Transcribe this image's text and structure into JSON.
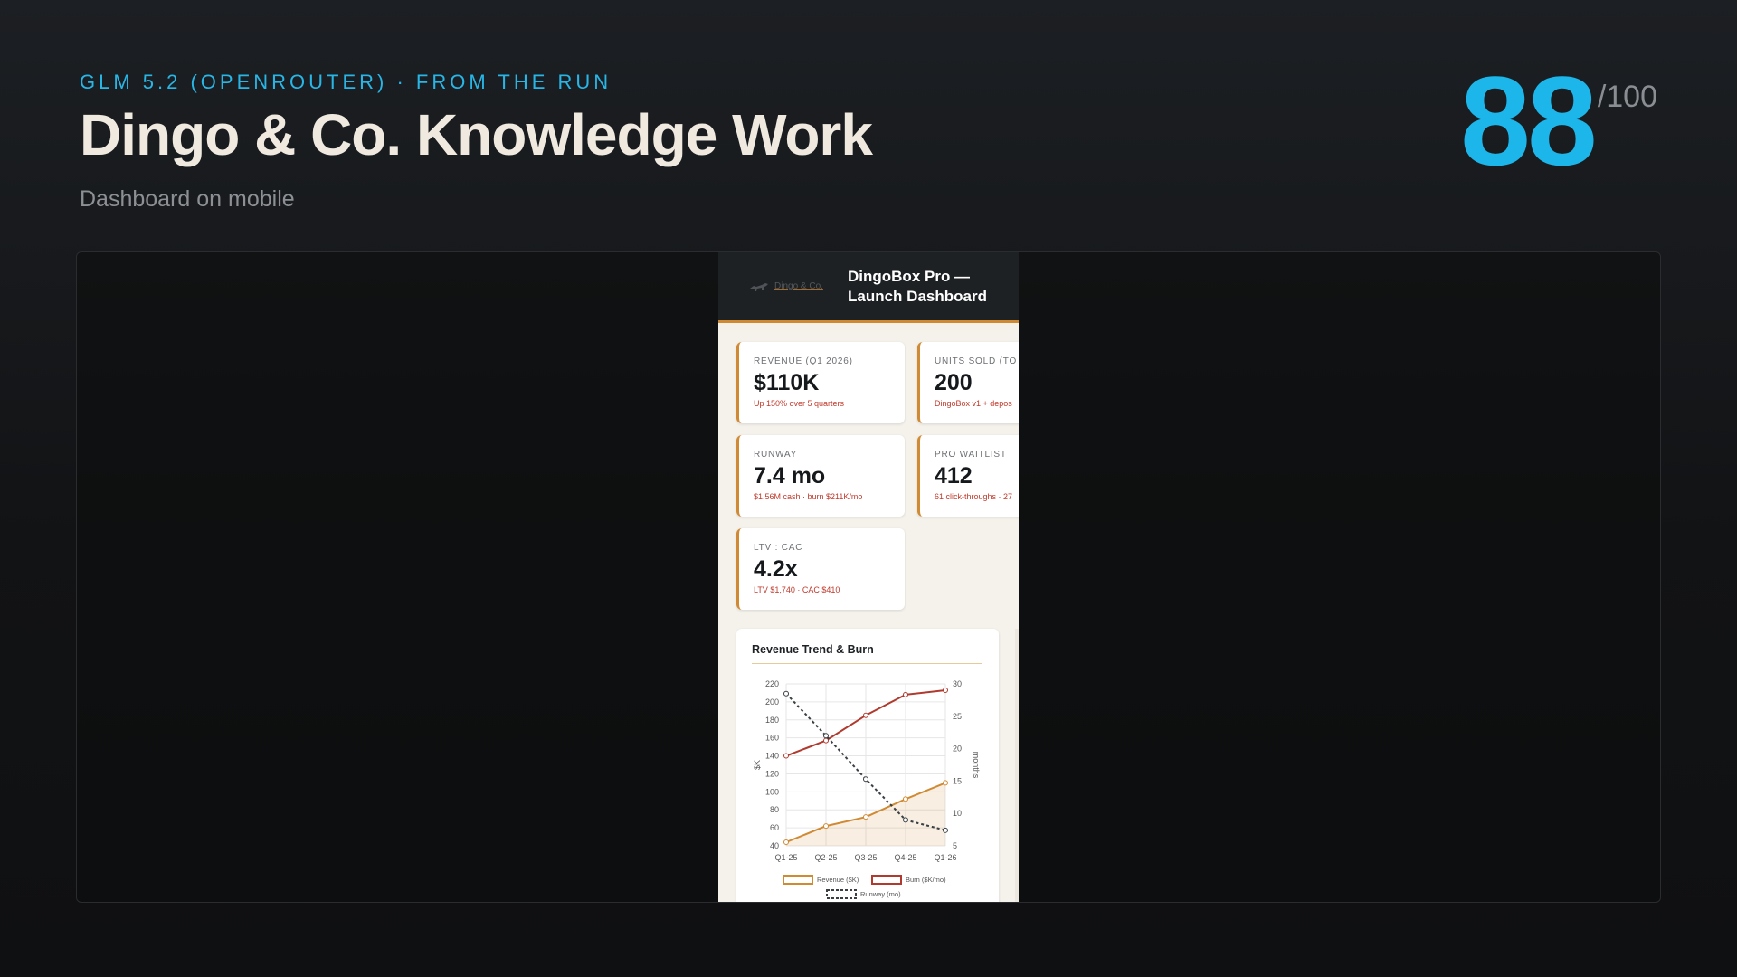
{
  "header": {
    "eyebrow": "GLM 5.2 (OPENROUTER) · FROM THE RUN",
    "title": "Dingo & Co. Knowledge Work",
    "subtitle": "Dashboard on mobile",
    "score": "88",
    "score_max": "/100"
  },
  "colors": {
    "accent": "#1cb6ea",
    "brand": "#d08a33",
    "alert": "#c0392b"
  },
  "phone": {
    "logo_text": "Dingo & Co.",
    "logo_icon": "dingo-icon",
    "title_line1": "DingoBox Pro —",
    "title_line2": "Launch Dashboard",
    "kpis": [
      {
        "label": "REVENUE (Q1 2026)",
        "value": "$110K",
        "note": "Up 150% over 5 quarters"
      },
      {
        "label": "UNITS SOLD (TO D",
        "value": "200",
        "note": "DingoBox v1 + depos"
      },
      {
        "label": "RUNWAY",
        "value": "7.4 mo",
        "note": "$1.56M cash · burn $211K/mo"
      },
      {
        "label": "PRO WAITLIST",
        "value": "412",
        "note": "61 click-throughs · 27"
      },
      {
        "label": "LTV : CAC",
        "value": "4.2x",
        "note": "LTV $1,740 · CAC $410"
      }
    ]
  },
  "chart_data": {
    "type": "line",
    "title": "Revenue Trend & Burn",
    "categories": [
      "Q1-25",
      "Q2-25",
      "Q3-25",
      "Q4-25",
      "Q1-26"
    ],
    "ylabel": "$K",
    "y2label": "months",
    "ylim": [
      40,
      220
    ],
    "y2lim": [
      5,
      30
    ],
    "yticks": [
      "220",
      "200",
      "180",
      "160",
      "140",
      "120",
      "100",
      "80",
      "60",
      "40"
    ],
    "y2ticks": [
      "30",
      "25",
      "20",
      "15",
      "10",
      "5"
    ],
    "grid": true,
    "legend_position": "bottom",
    "series": [
      {
        "name": "Revenue ($K)",
        "axis": "left",
        "color": "#d08a33",
        "area": true,
        "values": [
          44,
          62,
          72,
          92,
          110
        ]
      },
      {
        "name": "Burn ($K/mo)",
        "axis": "left",
        "color": "#b03a2e",
        "values": [
          140,
          157,
          185,
          208,
          213
        ]
      },
      {
        "name": "Runway (mo)",
        "axis": "right",
        "color": "#3a3f44",
        "dashed": true,
        "values": [
          28.5,
          22,
          15.3,
          9,
          7.4
        ]
      }
    ]
  }
}
